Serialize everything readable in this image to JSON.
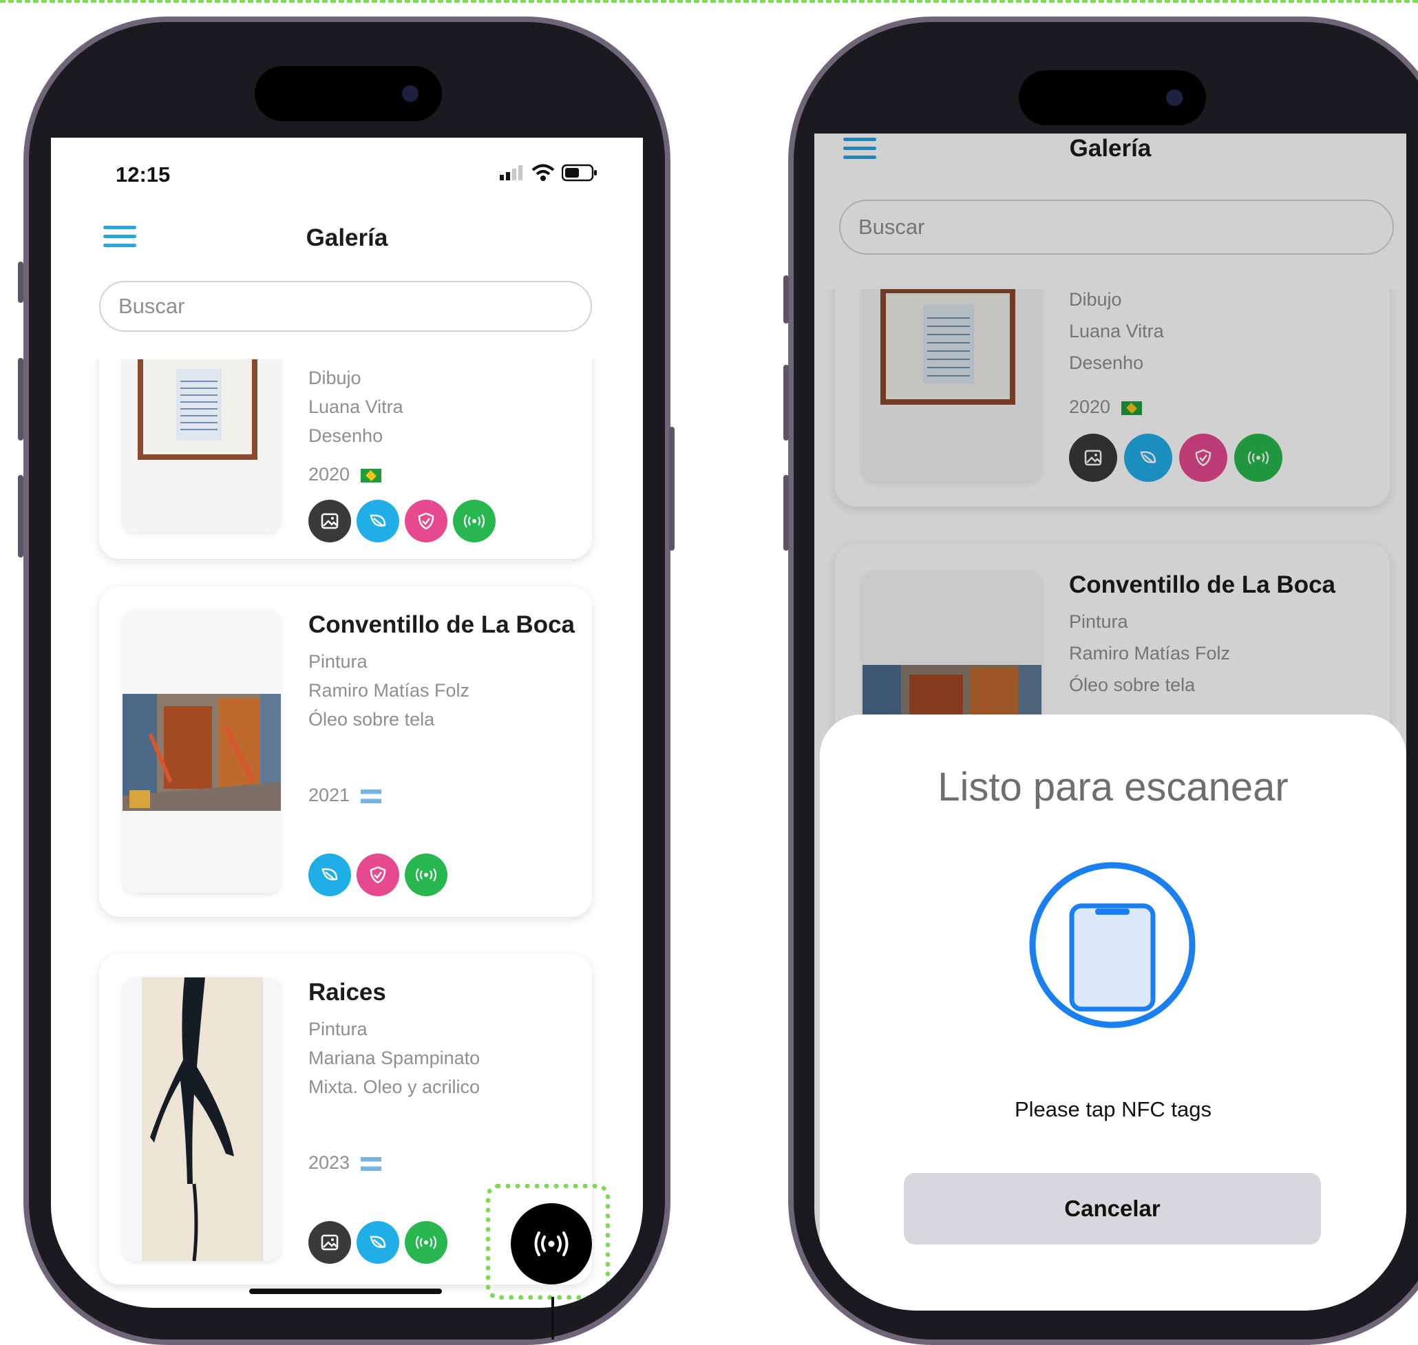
{
  "status_bar": {
    "time": "12:15"
  },
  "app": {
    "title": "Galería",
    "search_placeholder": "Buscar"
  },
  "artworks": [
    {
      "title": "",
      "type": "Dibujo",
      "artist": "Luana Vitra",
      "technique": "Desenho",
      "year": "2020",
      "country_flag": "brazil-flag",
      "actions": [
        "image-icon",
        "leaf-icon",
        "shield-icon",
        "nfc-icon"
      ]
    },
    {
      "title": "Conventillo de La Boca",
      "type": "Pintura",
      "artist": "Ramiro Matías Folz",
      "technique": "Óleo sobre tela",
      "year": "2021",
      "country_flag": "argentina-flag",
      "actions": [
        "leaf-icon",
        "shield-icon",
        "nfc-icon"
      ]
    },
    {
      "title": "Raices",
      "type": "Pintura",
      "artist": "Mariana Spampinato",
      "technique": "Mixta. Oleo y acrilico",
      "year": "2023",
      "country_flag": "argentina-flag",
      "actions": [
        "image-icon",
        "leaf-icon",
        "nfc-icon"
      ]
    }
  ],
  "nfc_sheet": {
    "title": "Listo para escanear",
    "message": "Please tap NFC tags",
    "cancel_label": "Cancelar"
  },
  "colors": {
    "menu": "#2ba3dd",
    "dark": "#3a3a3c",
    "blue": "#20aee7",
    "pink": "#e6498e",
    "green": "#28b74e",
    "highlight": "#7ed957",
    "nfc_ring": "#1a7ff0"
  }
}
